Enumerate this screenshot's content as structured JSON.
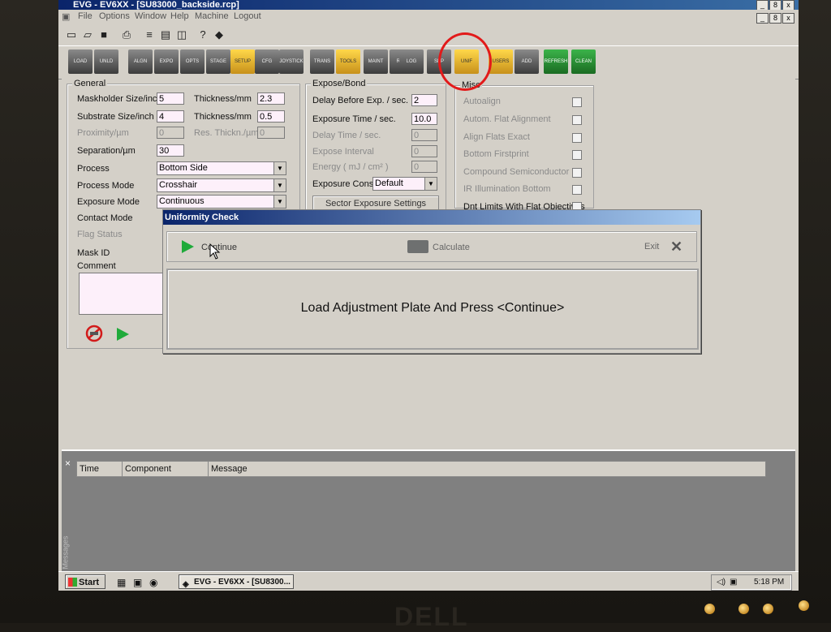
{
  "window": {
    "title": "EVG - EV6XX - [SU83000_backside.rcp]",
    "controls": [
      "_",
      "8",
      "x"
    ]
  },
  "menu": [
    "File",
    "Options",
    "Window",
    "Help",
    "Machine",
    "Logout"
  ],
  "toolbar_icons": [
    "new-icon",
    "open-icon",
    "save-icon",
    "print-icon",
    "grid-icon",
    "window-icon",
    "layout-icon",
    "help-icon",
    "info-icon"
  ],
  "big_toolbar": [
    "LOAD",
    "UNLD",
    "ALGN",
    "EXPO",
    "OPTS",
    "STAGE",
    "SETUP",
    "CFG",
    "JOYSTICK",
    "TRANS",
    "TOOLS",
    "MAINT",
    "RCP",
    "LOG",
    "SEP",
    "UNIF",
    "USERS",
    "ADD",
    "REFRESH",
    "CLEAN"
  ],
  "general": {
    "title": "General",
    "maskholder_label": "Maskholder Size/inch",
    "maskholder_value": "5",
    "thickness1_label": "Thickness/mm",
    "thickness1_value": "2.3",
    "substrate_label": "Substrate Size/inch",
    "substrate_value": "4",
    "thickness2_label": "Thickness/mm",
    "thickness2_value": "0.5",
    "proximity_label": "Proximity/µm",
    "proximity_value": "0",
    "res_label": "Res. Thickn./µm",
    "res_value": "0",
    "separation_label": "Separation/µm",
    "separation_value": "30",
    "process_label": "Process",
    "process_value": "Bottom Side",
    "process_mode_label": "Process Mode",
    "process_mode_value": "Crosshair",
    "exposure_mode_label": "Exposure Mode",
    "exposure_mode_value": "Continuous",
    "contact_mode_label": "Contact Mode",
    "flag_status_label": "Flag Status",
    "mask_id_label": "Mask ID",
    "comment_label": "Comment"
  },
  "expose": {
    "title": "Expose/Bond",
    "delay_label": "Delay Before Exp. / sec.",
    "delay_value": "2",
    "exposure_time_label": "Exposure Time / sec.",
    "exposure_time_value": "10.0",
    "delay_time_label": "Delay Time / sec.",
    "delay_time_value": "0",
    "interval_label": "Expose Interval",
    "interval_value": "0",
    "energy_label": "Energy ( mJ / cm² )",
    "energy_value": "0",
    "const_label": "Exposure Const.",
    "const_value": "Default",
    "sector_button": "Sector Exposure Settings"
  },
  "misc": {
    "title": "Misc",
    "items": [
      "Autoalign",
      "Autom. Flat Alignment",
      "Align Flats Exact",
      "Bottom Firstprint",
      "Compound Semiconductor",
      "IR Illumination Bottom",
      "Dnt Limits With Flat Objectives"
    ]
  },
  "dialog": {
    "title": "Uniformity Check",
    "continue_label": "Continue",
    "calculate_label": "Calculate",
    "exit_label": "Exit",
    "message": "Load Adjustment Plate And Press <Continue>"
  },
  "messages": {
    "close": "×",
    "side_label": "Messages",
    "columns": [
      "Time",
      "Component",
      "Message"
    ]
  },
  "taskbar": {
    "start": "Start",
    "task": "EVG - EV6XX - [SU8300...",
    "clock": "5:18 PM"
  },
  "monitor": {
    "brand": "DELL"
  },
  "colors": {
    "field_bg": "#fdf0fa",
    "accent_play": "#1faa3a",
    "title_blue": "#0a246a",
    "annotation": "#e21a1a"
  }
}
